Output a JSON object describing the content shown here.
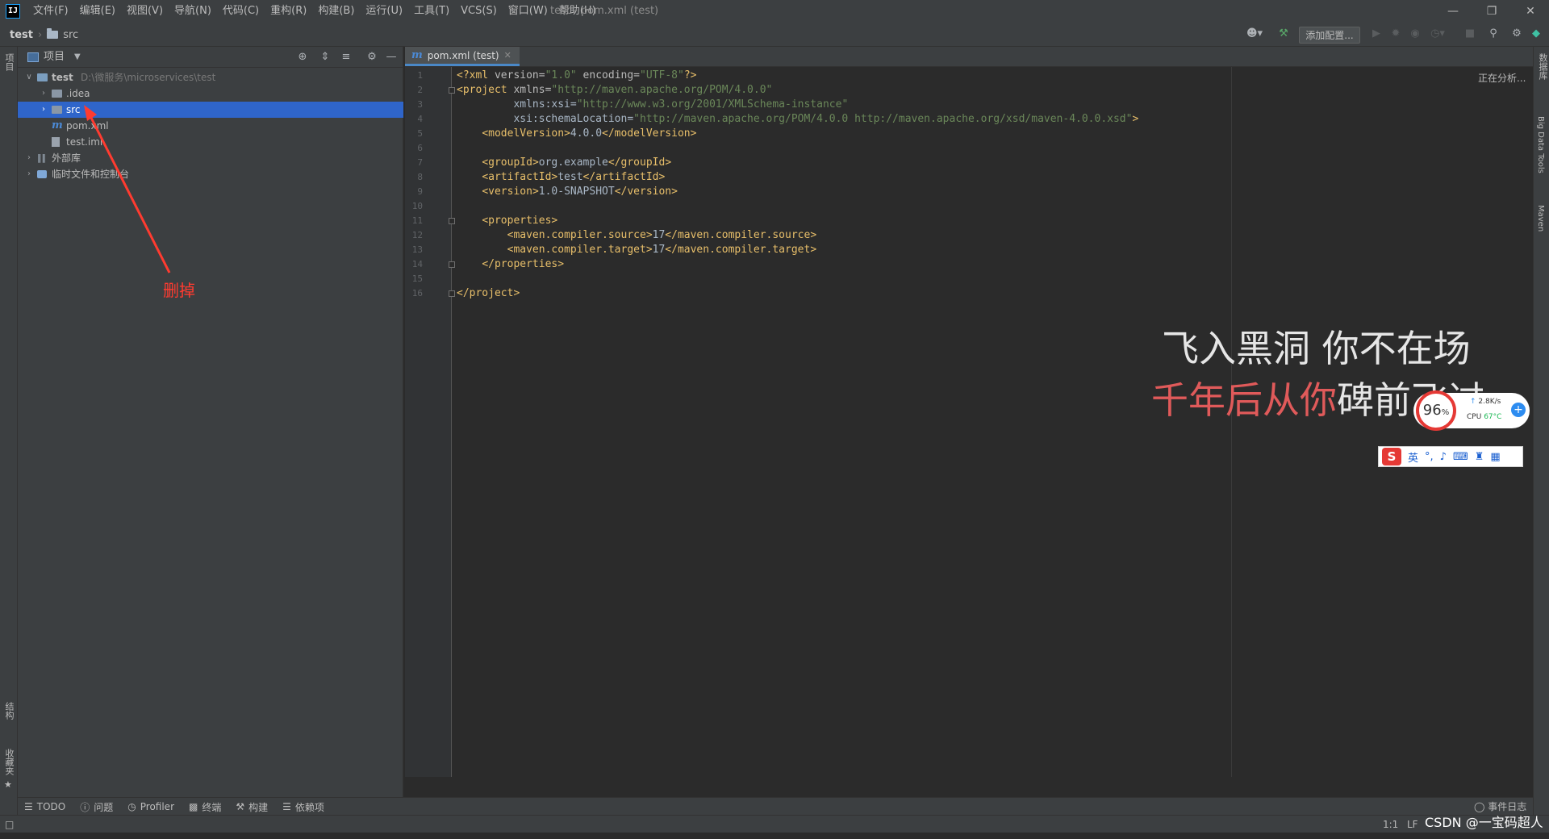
{
  "menubar": {
    "items": [
      "文件(F)",
      "编辑(E)",
      "视图(V)",
      "导航(N)",
      "代码(C)",
      "重构(R)",
      "构建(B)",
      "运行(U)",
      "工具(T)",
      "VCS(S)",
      "窗口(W)",
      "帮助(H)"
    ],
    "window_title": "test - pom.xml (test)",
    "logo_text": "IJ"
  },
  "navbar": {
    "crumb_root": "test",
    "crumb_child": "src",
    "add_config_label": "添加配置..."
  },
  "left_strip": {
    "project_label": "项目",
    "structure_label": "结构",
    "favorites_label": "收藏夹"
  },
  "project_panel": {
    "title": "项目",
    "tree": [
      {
        "label": "test",
        "hint": "D:\\微服务\\microservices\\test",
        "depth": 0,
        "expanded": true,
        "icon": "module-folder"
      },
      {
        "label": ".idea",
        "depth": 1,
        "expanded": false,
        "icon": "folder"
      },
      {
        "label": "src",
        "depth": 1,
        "expanded": false,
        "icon": "folder",
        "selected": true
      },
      {
        "label": "pom.xml",
        "depth": 1,
        "icon": "maven-file"
      },
      {
        "label": "test.iml",
        "depth": 1,
        "icon": "iml-file"
      },
      {
        "label": "外部库",
        "depth": 0,
        "expanded": false,
        "icon": "library"
      },
      {
        "label": "临时文件和控制台",
        "depth": 0,
        "expanded": false,
        "icon": "scratch"
      }
    ]
  },
  "annotation": {
    "delete_note": "删掉",
    "arrow_color": "#ff3b30"
  },
  "editor": {
    "tab_label": "pom.xml (test)",
    "status_text": "正在分析...",
    "lines": [
      "<?xml version=\"1.0\" encoding=\"UTF-8\"?>",
      "<project xmlns=\"http://maven.apache.org/POM/4.0.0\"",
      "         xmlns:xsi=\"http://www.w3.org/2001/XMLSchema-instance\"",
      "         xsi:schemaLocation=\"http://maven.apache.org/POM/4.0.0 http://maven.apache.org/xsd/maven-4.0.0.xsd\">",
      "    <modelVersion>4.0.0</modelVersion>",
      "",
      "    <groupId>org.example</groupId>",
      "    <artifactId>test</artifactId>",
      "    <version>1.0-SNAPSHOT</version>",
      "",
      "    <properties>",
      "        <maven.compiler.source>17</maven.compiler.source>",
      "        <maven.compiler.target>17</maven.compiler.target>",
      "    </properties>",
      "",
      "</project>"
    ],
    "line_numbers": [
      "1",
      "2",
      "3",
      "4",
      "5",
      "6",
      "7",
      "8",
      "9",
      "10",
      "11",
      "12",
      "13",
      "14",
      "15",
      "16"
    ]
  },
  "right_strip": {
    "database_label": "数据库",
    "bigdata_label": "Big Data Tools",
    "maven_label": "Maven"
  },
  "overlay": {
    "lyric_line1": "飞入黑洞 你不在场",
    "lyric_line2_highlight": "千年后从你",
    "lyric_line2_rest": "碑前飞过",
    "perf_percent": "96",
    "perf_percent_sign": "%",
    "net_speed": "2.8K/s",
    "cpu_label": "CPU",
    "cpu_temp": "67°C",
    "ime_lang": "英"
  },
  "bottom_tools": {
    "todo": "TODO",
    "problems": "问题",
    "profiler": "Profiler",
    "terminal": "终端",
    "build": "构建",
    "dependencies": "依赖项",
    "event_log": "事件日志"
  },
  "status_bar": {
    "position": "1:1",
    "line_sep": "LF",
    "watermark": "CSDN @一宝码超人"
  },
  "colors": {
    "selection": "#2f65ca",
    "panel_bg": "#3c3f41",
    "editor_bg": "#2b2b2b",
    "xml_tag": "#e8bf6a",
    "xml_string": "#6a8759",
    "xml_namespace": "#9876aa"
  }
}
